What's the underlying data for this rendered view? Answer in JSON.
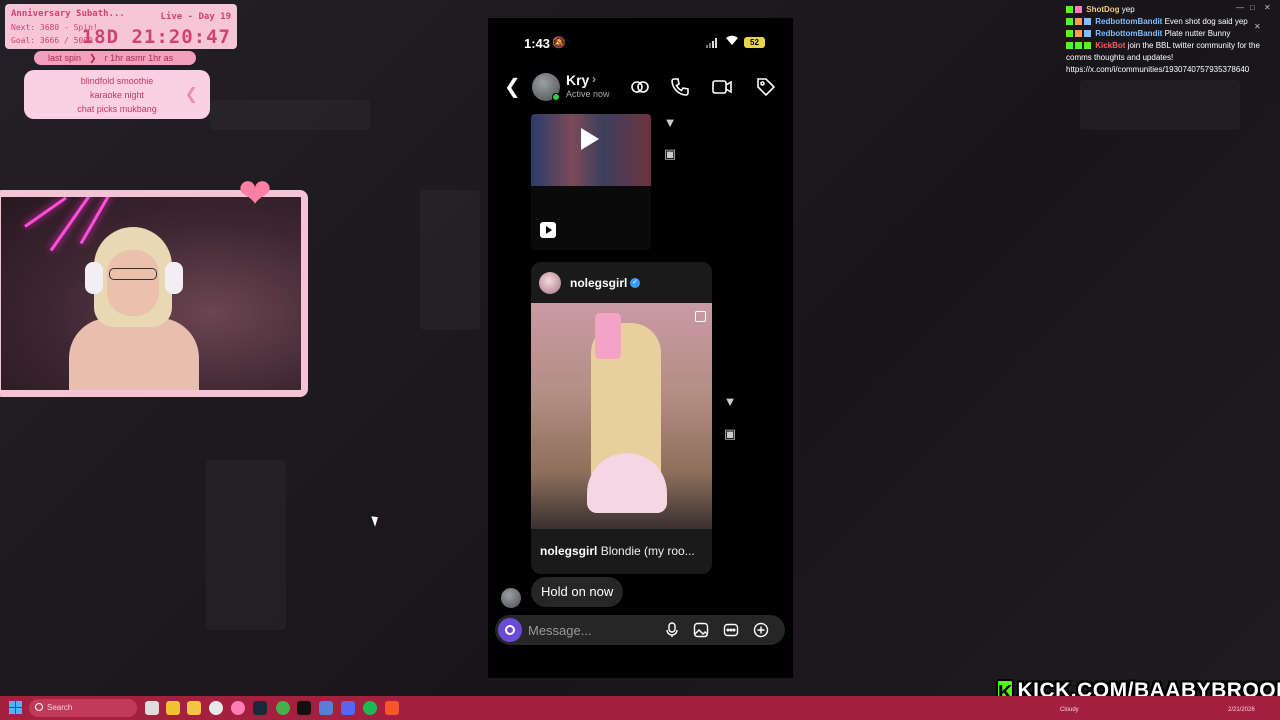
{
  "overlay": {
    "anniversary": {
      "title": "Anniversary Subath...",
      "next": "Next: 3680 - Spin!",
      "goal": "Goal: 3666 / 5000",
      "live": "Live - Day 19",
      "timer": "18D 21:20:47"
    },
    "last_spin": {
      "label": "last spin",
      "value": "r 1hr asmr 1hr as"
    },
    "spin_list": [
      "blindfold smoothie",
      "karaoke night",
      "chat picks mukbang"
    ]
  },
  "phone": {
    "status_time": "1:43",
    "battery": "52",
    "contact_name": "Kry",
    "contact_status": "Active now",
    "post": {
      "username": "nolegsgirl",
      "caption_user": "nolegsgirl",
      "caption_text": "Blondie (my roo..."
    },
    "last_message": "Hold on now",
    "composer_placeholder": "Message...",
    "header_icons": [
      "link-icon",
      "phone-icon",
      "video-icon",
      "tag-icon"
    ],
    "composer_icons": [
      "mic-icon",
      "gallery-icon",
      "sticker-icon",
      "plus-icon"
    ]
  },
  "stream_chat": [
    {
      "user": "ShotDog",
      "text": "yep",
      "color": "#f3c87a"
    },
    {
      "user": "RedbottomBandit",
      "text": "Even shot dog said yep",
      "color": "#7fbfff"
    },
    {
      "user": "RedbottomBandit",
      "text": "Plate nutter Bunny",
      "color": "#7fbfff"
    },
    {
      "user": "KickBot",
      "text": "join the BBL twitter community for the comms thoughts and updates!",
      "color": "#ff5b5b"
    },
    {
      "user": "",
      "text": "https://x.com/i/communities/1930740757935378640",
      "color": "#ffffff"
    }
  ],
  "kick": {
    "letter": "K",
    "url": "KICK.COM/BAABYBROOK"
  },
  "taskbar": {
    "search_placeholder": "Search",
    "weather": "Cloudy",
    "date": "2/21/2026"
  }
}
